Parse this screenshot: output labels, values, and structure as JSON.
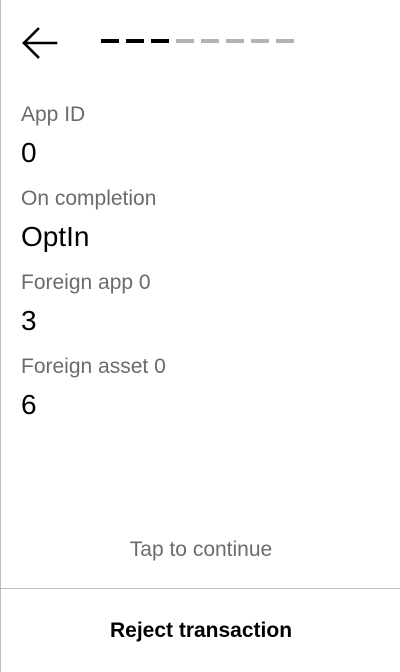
{
  "header": {
    "back_icon": "arrow-left-icon",
    "progress": {
      "total_steps": 8,
      "completed_steps": 3,
      "active_color": "#000000",
      "inactive_color": "#b3b3b3"
    }
  },
  "fields": [
    {
      "label": "App ID",
      "value": "0"
    },
    {
      "label": "On completion",
      "value": "OptIn"
    },
    {
      "label": "Foreign app 0",
      "value": "3"
    },
    {
      "label": "Foreign asset 0",
      "value": "6"
    }
  ],
  "footer": {
    "tap_to_continue": "Tap to continue",
    "reject_label": "Reject transaction"
  }
}
